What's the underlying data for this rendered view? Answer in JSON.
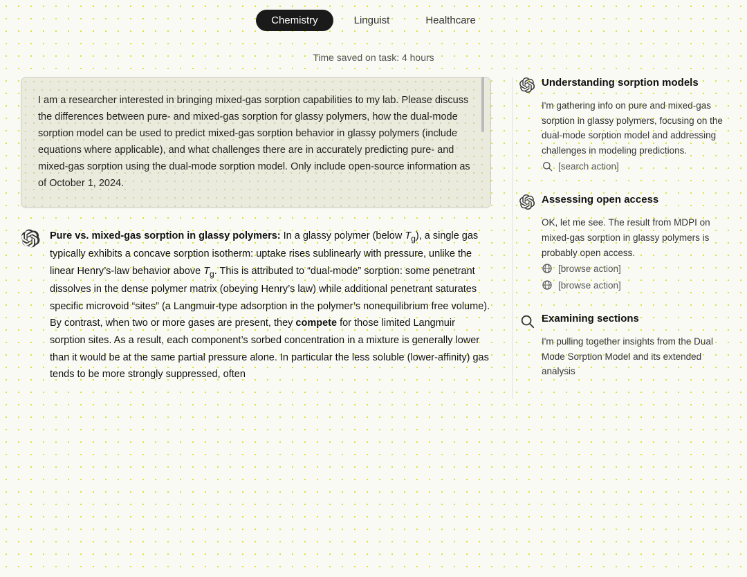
{
  "tabs": [
    {
      "label": "Chemistry",
      "active": true
    },
    {
      "label": "Linguist",
      "active": false
    },
    {
      "label": "Healthcare",
      "active": false
    }
  ],
  "time_saved": "Time saved on task: 4 hours",
  "prompt": {
    "text": "I am a researcher interested in bringing mixed-gas sorption capabilities to my lab. Please discuss the differences between pure- and mixed-gas sorption for glassy polymers, how the dual-mode sorption model can be used to predict mixed-gas sorption behavior in glassy polymers (include equations where applicable), and what challenges there are in accurately predicting pure- and mixed-gas sorption using the dual-mode sorption model. Only include open-source information as of October 1, 2024."
  },
  "response": {
    "title_bold": "Pure vs. mixed-gas sorption in glassy polymers:",
    "title_rest": " In a glassy polymer (below ",
    "tg1": "T",
    "tg1_sub": "g",
    "text1": "), a single gas typically exhibits a concave sorption isotherm: uptake rises sublinearly with pressure, unlike the linear Henry’s-law behavior above ",
    "tg2": "T",
    "tg2_sub": "g",
    "text2": ". This is attributed to “dual-mode” sorption: some penetrant dissolves in the dense polymer matrix (obeying Henry’s law) while additional penetrant saturates specific microvoid “sites” (a Langmuir-type adsorption in the polymer’s nonequilibrium free volume). By contrast, when two or more gases are present, they ",
    "compete_bold": "compete",
    "text3": " for those limited Langmuir sorption sites. As a result, each component’s sorbed concentration in a mixture is generally lower than it would be at the same partial pressure alone. In particular the less soluble (lower-affinity) gas tends to be more strongly suppressed, often"
  },
  "sidebar": {
    "items": [
      {
        "id": "understanding-sorption",
        "title": "Understanding sorption models",
        "desc": "I'm gathering info on pure and mixed-gas sorption in glassy polymers, focusing on the dual-mode sorption model and addressing challenges in modeling predictions.",
        "action": {
          "icon": "search",
          "label": "[search action]"
        }
      },
      {
        "id": "assessing-open-access",
        "title": "Assessing open access",
        "desc": "OK, let me see. The result from MDPI on mixed-gas sorption in glassy polymers is probably open access.",
        "actions": [
          {
            "icon": "browse",
            "label": "[browse action]"
          },
          {
            "icon": "browse",
            "label": "[browse action]"
          }
        ]
      },
      {
        "id": "examining-sections",
        "title": "Examining sections",
        "desc": "I'm pulling together insights from the Dual Mode Sorption Model and its extended analysis"
      }
    ]
  }
}
